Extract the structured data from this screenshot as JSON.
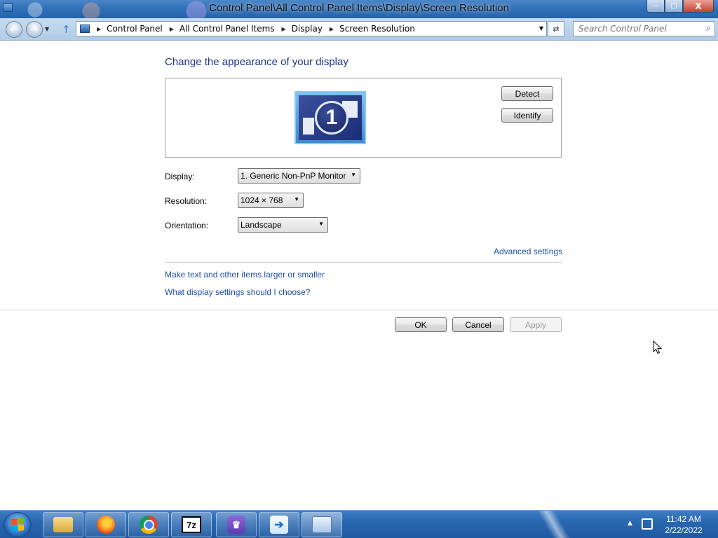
{
  "window": {
    "title": "Control Panel\\All Control Panel Items\\Display\\Screen Resolution",
    "controls": {
      "minimize": "—",
      "maximize": "□",
      "close": "X"
    }
  },
  "addressbar": {
    "back_icon": "←",
    "forward_icon": "→",
    "up_icon": "↑",
    "breadcrumbs": [
      "Control Panel",
      "All Control Panel Items",
      "Display",
      "Screen Resolution"
    ],
    "refresh_icon": "⇄",
    "search_placeholder": "Search Control Panel",
    "search_icon": "⌕"
  },
  "main": {
    "heading": "Change the appearance of your display",
    "monitor_number": "1",
    "detect_label": "Detect",
    "identify_label": "Identify",
    "display_label": "Display:",
    "display_value": "1. Generic Non-PnP Monitor",
    "resolution_label": "Resolution:",
    "resolution_value": "1024 × 768",
    "orientation_label": "Orientation:",
    "orientation_value": "Landscape",
    "advanced_link": "Advanced settings",
    "text_size_link": "Make text and other items larger or smaller",
    "help_link": "What display settings should I choose?",
    "ok_label": "OK",
    "cancel_label": "Cancel",
    "apply_label": "Apply"
  },
  "taskbar": {
    "apps": [
      {
        "name": "Windows Explorer",
        "icon": "folder-icon",
        "glyph": ""
      },
      {
        "name": "Firefox",
        "icon": "firefox-icon",
        "glyph": ""
      },
      {
        "name": "Google Chrome",
        "icon": "chrome-icon",
        "glyph": ""
      },
      {
        "name": "7-Zip",
        "icon": "7zip-icon",
        "glyph": "7z"
      },
      {
        "name": "Brave",
        "icon": "brave-icon",
        "glyph": "♛"
      },
      {
        "name": "App",
        "icon": "arrow-app-icon",
        "glyph": "➔"
      },
      {
        "name": "Control Panel",
        "icon": "control-panel-icon",
        "glyph": ""
      }
    ],
    "clock_time": "11:42 AM",
    "clock_date": "2/22/2022",
    "tray_up_icon": "▲"
  }
}
